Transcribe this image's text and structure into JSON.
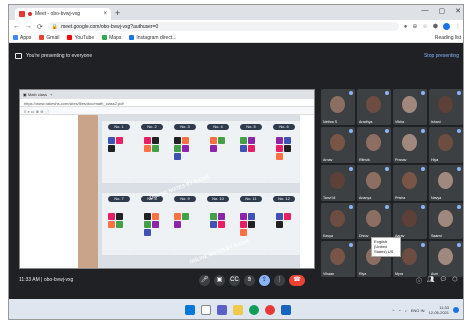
{
  "browser": {
    "tab_title": "Meet - obo-bvwj-vxg",
    "url": "meet.google.com/obo-bvwj-vxg?authuser=0",
    "bookmarks": [
      "Apps",
      "Gmail",
      "YouTube",
      "Maps",
      "Instagram direct...",
      "Reading list"
    ]
  },
  "meet": {
    "presenting_text": "You're presenting to everyone",
    "stop_text": "Stop presenting",
    "time_code": "11:33 AM  |  obo-bvwj-vxg",
    "tooltip": "English (United States) US",
    "watermark": "ONLINE NOTES BY RASHI"
  },
  "shared_screen": {
    "address": "https://www.rakeshs.com/sites/files/doc/math_class2.pdf",
    "cards_top": [
      "No. 1",
      "No. 2",
      "No. 3",
      "No. 4",
      "No. 5",
      "No. 6"
    ],
    "cards_bottom": [
      "No. 7",
      "No. 8",
      "No. 9",
      "No. 10",
      "No. 11",
      "No. 12"
    ]
  },
  "participants": [
    {
      "name": "Nethra S",
      "color": "#8d6e63"
    },
    {
      "name": "Aradhya",
      "color": "#6d4c41"
    },
    {
      "name": "Vibha",
      "color": "#a1887f"
    },
    {
      "name": "Ishani",
      "color": "#5d4037"
    },
    {
      "name": "Arnav",
      "color": "#795548"
    },
    {
      "name": "Rithvik",
      "color": "#8d6e63"
    },
    {
      "name": "Pranav",
      "color": "#a1887f"
    },
    {
      "name": "Hiya",
      "color": "#6d4c41"
    },
    {
      "name": "Tanvi M",
      "color": "#5d4037"
    },
    {
      "name": "Ananya",
      "color": "#8d6e63"
    },
    {
      "name": "Prisha",
      "color": "#795548"
    },
    {
      "name": "Navya",
      "color": "#a1887f"
    },
    {
      "name": "Kavya",
      "color": "#6d4c41"
    },
    {
      "name": "Dhruv",
      "color": "#8d6e63"
    },
    {
      "name": "Aarav",
      "color": "#5d4037"
    },
    {
      "name": "Saanvi",
      "color": "#a1887f"
    },
    {
      "name": "Vihaan",
      "color": "#795548"
    },
    {
      "name": "Riya",
      "color": "#8d6e63"
    },
    {
      "name": "Myra",
      "color": "#6d4c41"
    },
    {
      "name": "Avni",
      "color": "#a1887f"
    }
  ],
  "taskbar": {
    "clock_time": "11:33",
    "clock_date": "12-05-2021",
    "lang": "ENG IN"
  }
}
